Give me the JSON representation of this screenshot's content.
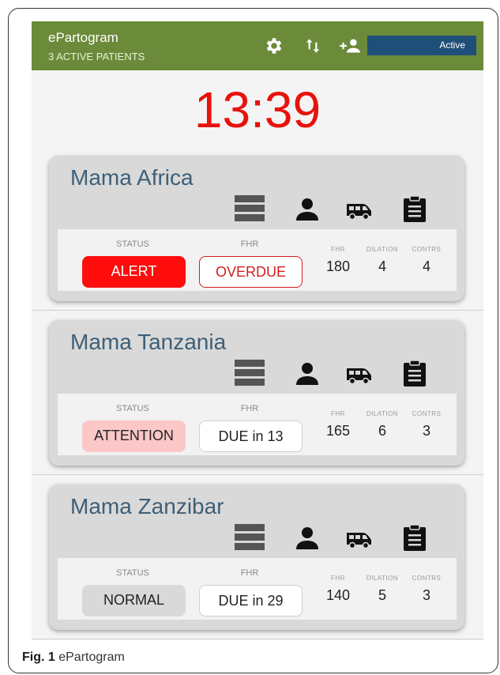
{
  "app": {
    "title": "ePartogram",
    "subtitle": "3 ACTIVE PATIENTS",
    "status_label": "Active",
    "header_color": "#6b8b3a",
    "icons": [
      "gear-icon",
      "sort-arrows-icon",
      "add-person-icon"
    ]
  },
  "clock": "13:39",
  "patients": [
    {
      "name": "Mama  Africa",
      "status_label": "STATUS",
      "status": "ALERT",
      "fhr_label": "FHR",
      "fhr_status": "OVERDUE",
      "metrics": [
        {
          "label": "FHR",
          "value": "180"
        },
        {
          "label": "DILATION",
          "value": "4"
        },
        {
          "label": "CONTRS",
          "value": "4"
        }
      ]
    },
    {
      "name": "Mama  Tanzania",
      "status_label": "STATUS",
      "status": "ATTENTION",
      "fhr_label": "FHR",
      "fhr_status": "DUE in 13",
      "metrics": [
        {
          "label": "FHR",
          "value": "165"
        },
        {
          "label": "DILATION",
          "value": "6"
        },
        {
          "label": "CONTRS",
          "value": "3"
        }
      ]
    },
    {
      "name": "Mama  Zanzibar",
      "status_label": "STATUS",
      "status": "NORMAL",
      "fhr_label": "FHR",
      "fhr_status": "DUE in 29",
      "metrics": [
        {
          "label": "FHR",
          "value": "140"
        },
        {
          "label": "DILATION",
          "value": "5"
        },
        {
          "label": "CONTRS",
          "value": "3"
        }
      ]
    }
  ],
  "card_icons": [
    "stack-icon",
    "person-icon",
    "ambulance-icon",
    "clipboard-icon"
  ],
  "caption": {
    "fig": "Fig. 1",
    "text": "ePartogram"
  }
}
